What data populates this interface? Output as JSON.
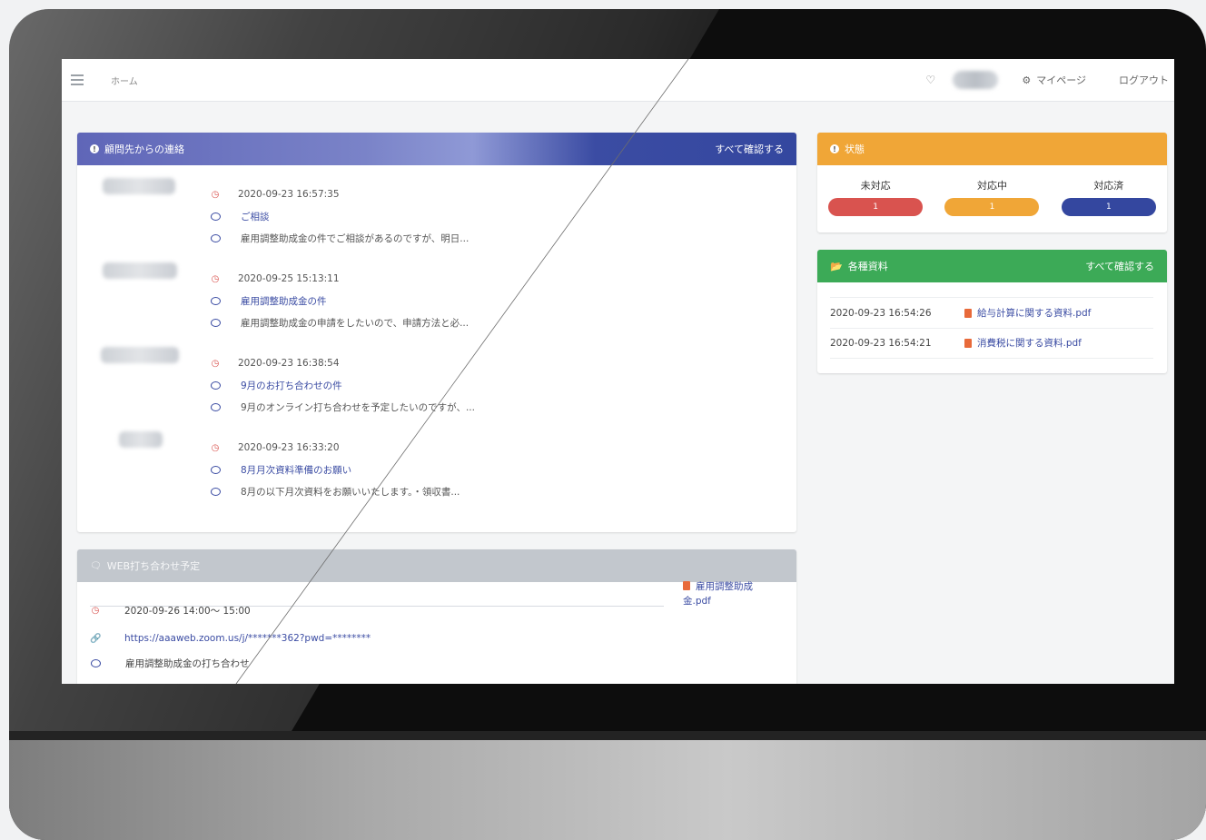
{
  "navbar": {
    "breadcrumb": "ホーム",
    "mypage_label": "マイページ",
    "logout_label": "ログアウト"
  },
  "messages": {
    "title": "顧問先からの連絡",
    "view_all": "すべて確認する",
    "items": [
      {
        "datetime": "2020-09-23 16:57:35",
        "subject": "ご相談",
        "preview": "雇用調整助成金の件でご相談があるのですが、明日..."
      },
      {
        "datetime": "2020-09-25 15:13:11",
        "subject": "雇用調整助成金の件",
        "preview": "雇用調整助成金の申請をしたいので、申請方法と必..."
      },
      {
        "datetime": "2020-09-23 16:38:54",
        "subject": "9月のお打ち合わせの件",
        "preview": "9月のオンライン打ち合わせを予定したいのですが、..."
      },
      {
        "datetime": "2020-09-23 16:33:20",
        "subject": "8月月次資料準備のお願い",
        "preview": "8月の以下月次資料をお願いいたします。・領収書..."
      }
    ]
  },
  "web_meetings": {
    "title": "WEB打ち合わせ予定",
    "datetime": "2020-09-26 14:00～ 15:00",
    "url": "https://aaaweb.zoom.us/j/*******362?pwd=********",
    "topic": "雇用調整助成金の打ち合わせ",
    "file_line1": "雇用調整助成",
    "file_line2": "金.pdf"
  },
  "status": {
    "title": "状態",
    "columns": [
      {
        "label": "未対応",
        "count": "1",
        "color": "#d9534f"
      },
      {
        "label": "対応中",
        "count": "1",
        "color": "#f0a637"
      },
      {
        "label": "対応済",
        "count": "1",
        "color": "#34479f"
      }
    ]
  },
  "documents": {
    "title": "各種資料",
    "view_all": "すべて確認する",
    "items": [
      {
        "datetime": "2020-09-23 16:54:26",
        "file": "給与計算に関する資料.pdf"
      },
      {
        "datetime": "2020-09-23 16:54:21",
        "file": "消費税に関する資料.pdf"
      }
    ]
  }
}
